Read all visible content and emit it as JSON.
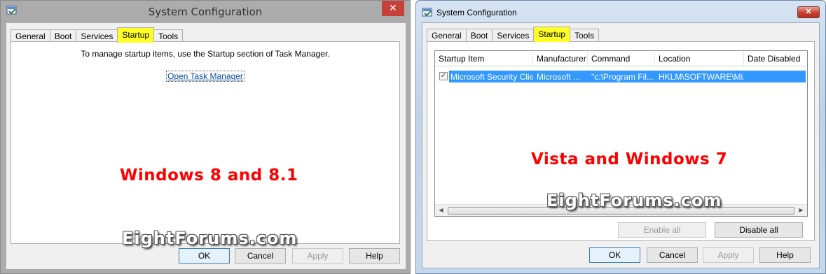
{
  "win8": {
    "title": "System Configuration",
    "close_glyph": "✕",
    "tabs": [
      "General",
      "Boot",
      "Services",
      "Startup",
      "Tools"
    ],
    "message": "To manage startup items, use the Startup section of Task Manager.",
    "link": "Open Task Manager",
    "label": "Windows 8 and 8.1",
    "watermark": "EightForums.com",
    "buttons": {
      "ok": "OK",
      "cancel": "Cancel",
      "apply": "Apply",
      "help": "Help"
    }
  },
  "win7": {
    "title": "System Configuration",
    "close_glyph": "✕",
    "tabs": [
      "General",
      "Boot",
      "Services",
      "Startup",
      "Tools"
    ],
    "columns": [
      "Startup Item",
      "Manufacturer",
      "Command",
      "Location",
      "Date Disabled"
    ],
    "row": {
      "checked_glyph": "✓",
      "item": "Microsoft Security Client",
      "manufacturer": "Microsoft ...",
      "command": "\"c:\\Program Fil...",
      "location": "HKLM\\SOFTWARE\\Mi...",
      "date_disabled": ""
    },
    "scroll_left": "◀",
    "scroll_right": "▶",
    "label": "Vista and Windows 7",
    "watermark": "EightForums.com",
    "buttons": {
      "enable_all": "Enable all",
      "disable_all": "Disable all",
      "ok": "OK",
      "cancel": "Cancel",
      "apply": "Apply",
      "help": "Help"
    }
  },
  "colors": {
    "highlight_tab": "#ffff27",
    "label_red": "#ff0000",
    "selection": "#3399ff"
  }
}
